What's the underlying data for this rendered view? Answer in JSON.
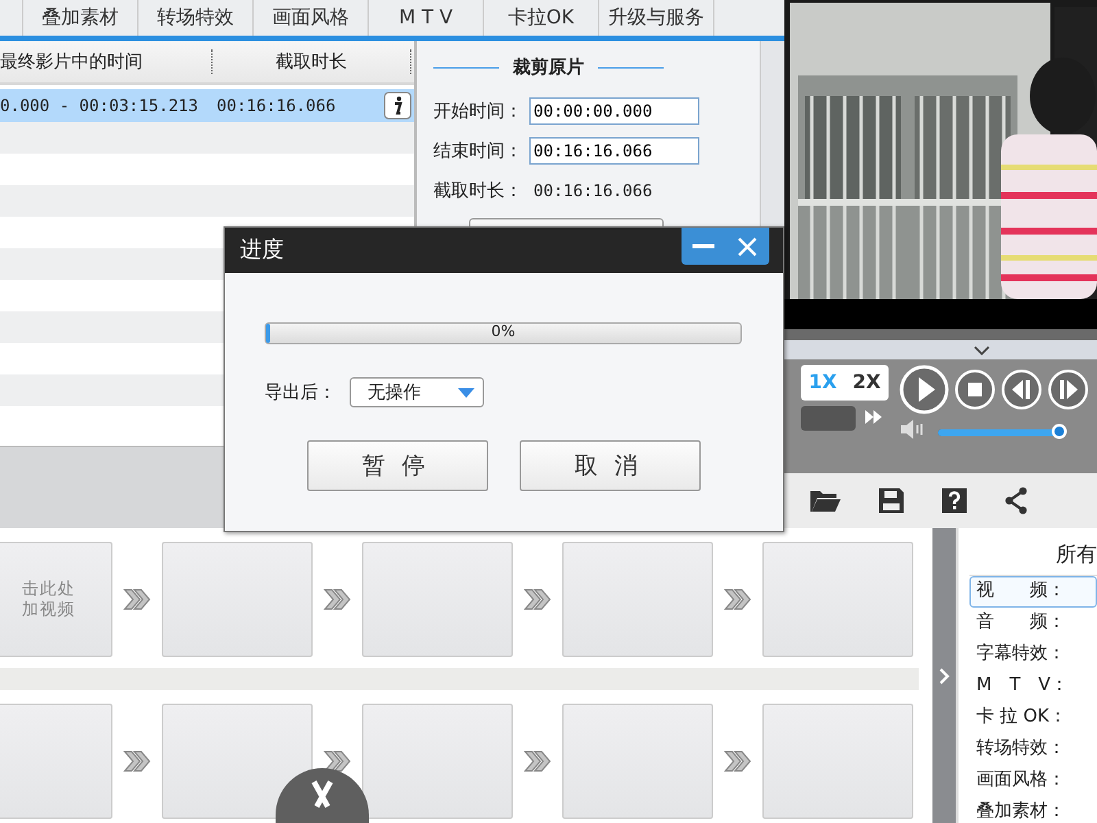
{
  "tabs": [
    "叠加素材",
    "转场特效",
    "画面风格",
    "M T V",
    "卡拉OK",
    "升级与服务"
  ],
  "table": {
    "columns": [
      "最终影片中的时间",
      "截取时长"
    ],
    "rows": [
      {
        "time_range": "0.000 - 00:03:15.213",
        "duration": "00:16:16.066",
        "selected": true
      }
    ]
  },
  "crop_panel": {
    "title": "裁剪原片",
    "fields": [
      {
        "label": "开始时间：",
        "value": "00:00:00.000",
        "kind": "input"
      },
      {
        "label": "结束时间：",
        "value": "00:16:16.066",
        "kind": "input"
      },
      {
        "label": "截取时长：",
        "value": "00:16:16.066",
        "kind": "text"
      }
    ]
  },
  "player": {
    "speeds": [
      {
        "label": "1X",
        "selected": true
      },
      {
        "label": "2X",
        "selected": false
      }
    ],
    "volume": {
      "level": 0.97
    }
  },
  "storyboard": {
    "placeholder_lines": [
      "击此处",
      "加视频"
    ]
  },
  "properties_panel": {
    "title": "所有",
    "items": [
      {
        "label": "视　　频：",
        "selected": true
      },
      {
        "label": "音　　频：",
        "selected": false
      },
      {
        "label": "字幕特效：",
        "selected": false
      },
      {
        "label": "M　T　V：",
        "selected": false
      },
      {
        "label": "卡 拉 OK：",
        "selected": false
      },
      {
        "label": "转场特效：",
        "selected": false
      },
      {
        "label": "画面风格：",
        "selected": false
      },
      {
        "label": "叠加素材：",
        "selected": false
      }
    ]
  },
  "dialog": {
    "title": "进度",
    "progress": {
      "level": 0.01,
      "label": "0%"
    },
    "after_export": {
      "label": "导出后：",
      "value": "无操作"
    },
    "buttons": [
      "暂停",
      "取消"
    ]
  }
}
